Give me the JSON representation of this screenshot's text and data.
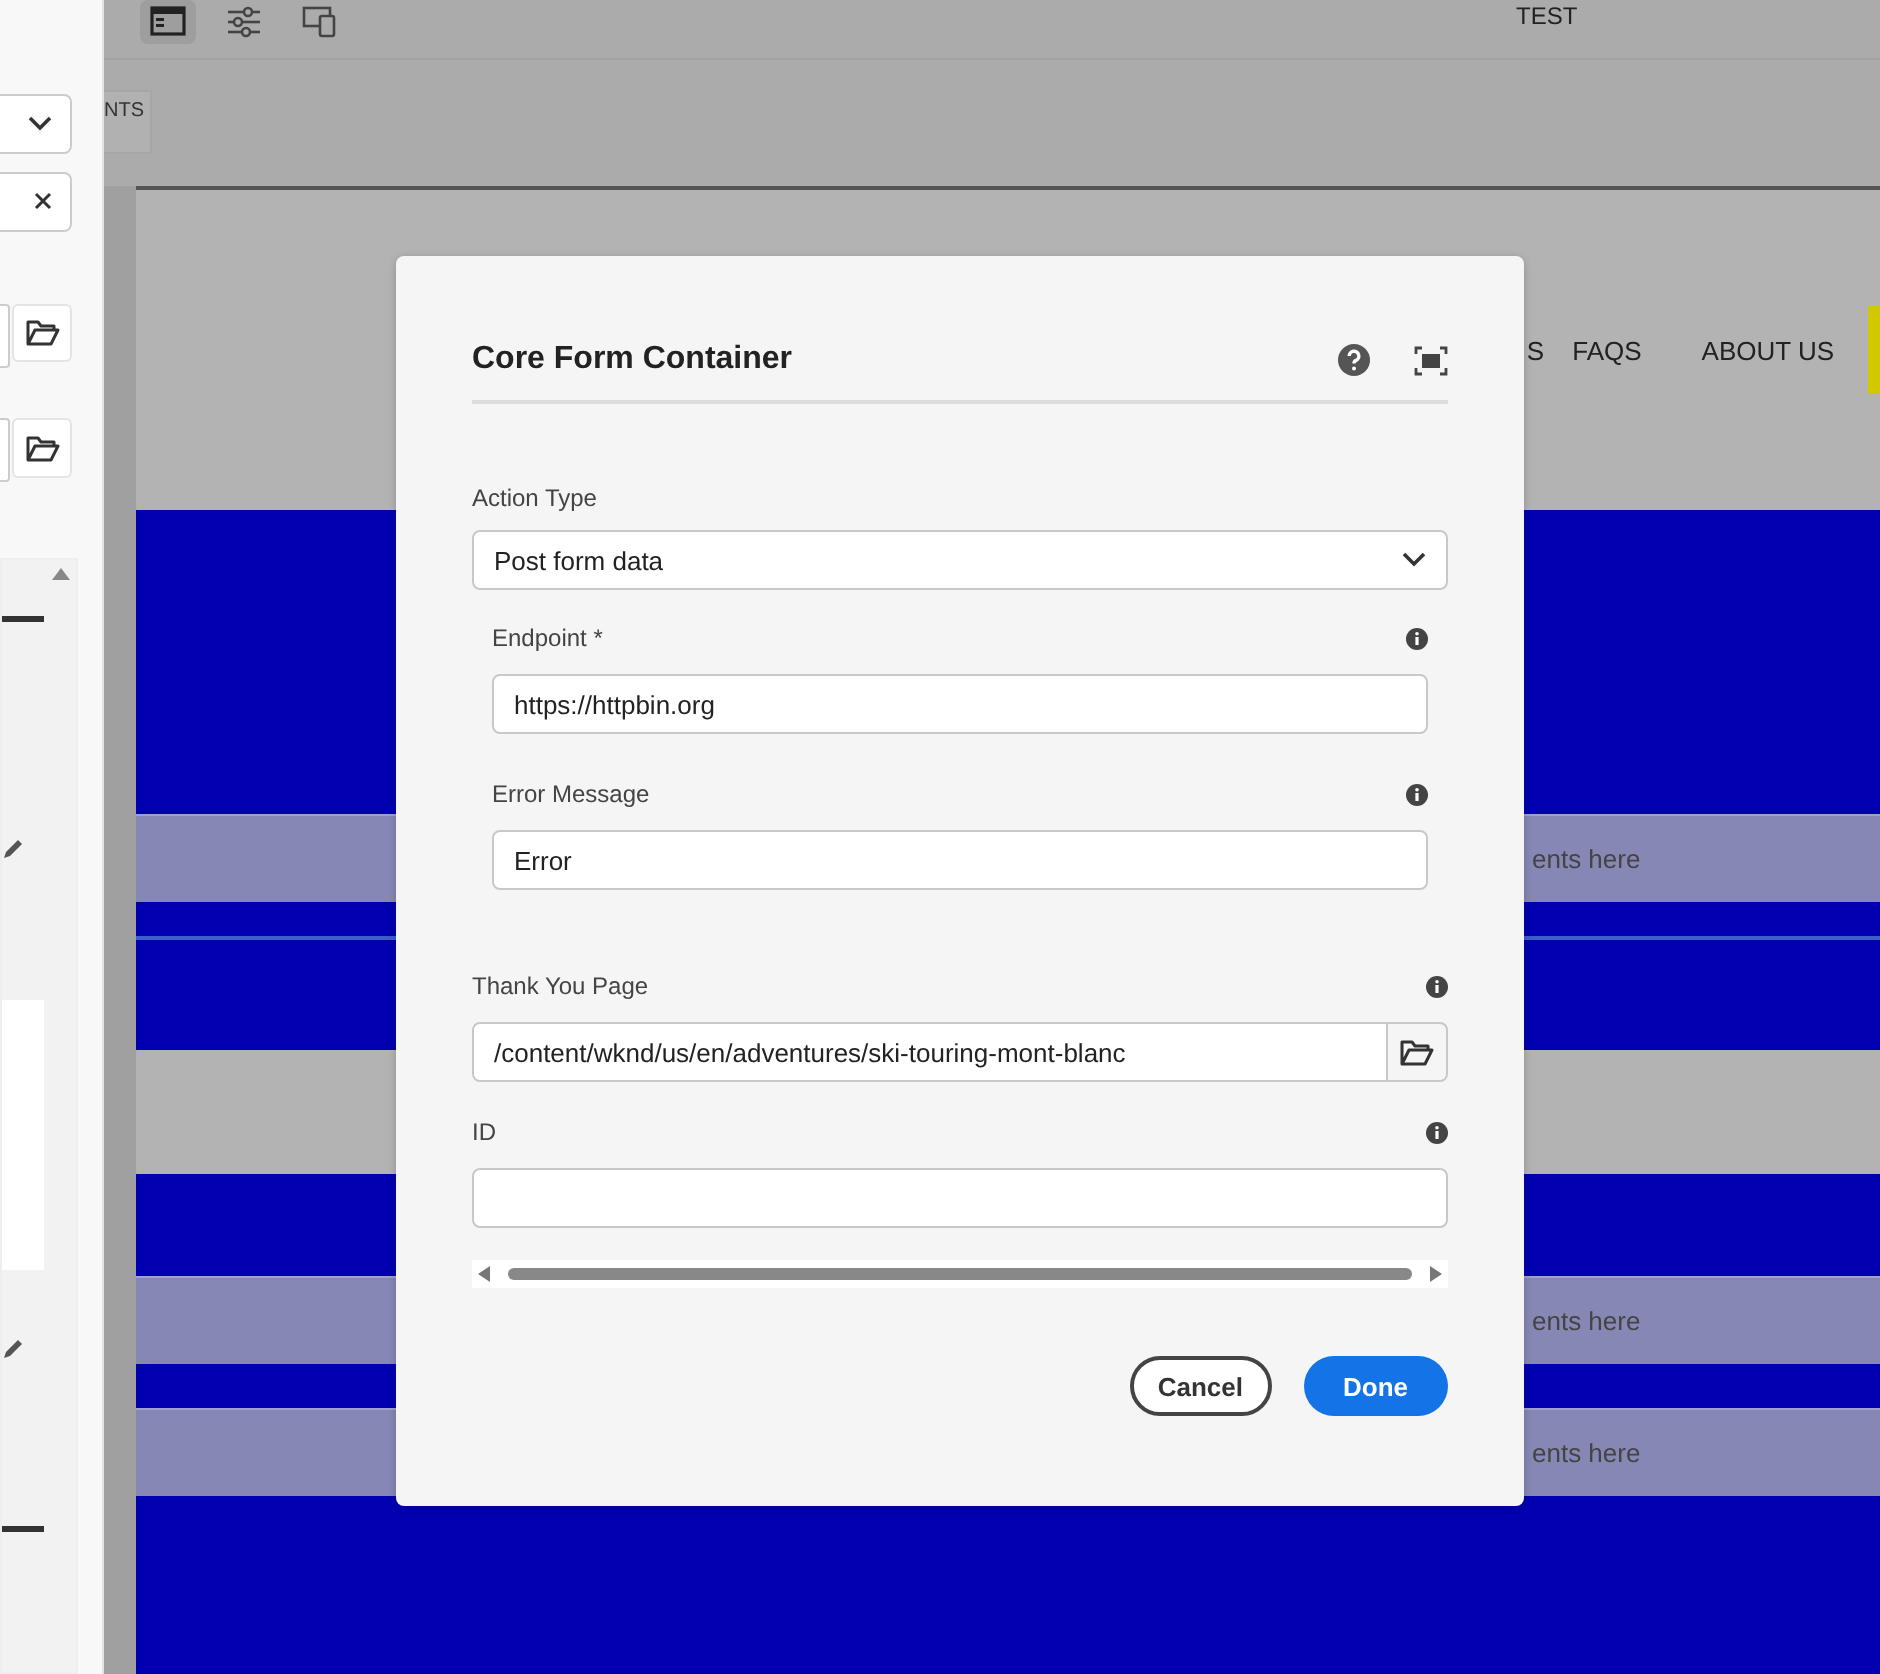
{
  "toolbar": {
    "buttons": [
      {
        "selected": true
      },
      {
        "selected": false
      },
      {
        "selected": false
      }
    ],
    "title": "TEST"
  },
  "side_tab": "NTS",
  "page": {
    "nav": [
      "S",
      "FAQS",
      "ABOUT US"
    ],
    "bands": [
      {
        "kind": "placeholder",
        "text": "ents here"
      },
      {
        "kind": "separator"
      },
      {
        "kind": "gray"
      },
      {
        "kind": "placeholder",
        "text": "ents here"
      },
      {
        "kind": "placeholder",
        "text": "ents here"
      }
    ]
  },
  "dialog": {
    "title": "Core Form Container",
    "fields": [
      {
        "kind": "select",
        "label": "Action Type",
        "value": "Post form data"
      },
      {
        "kind": "group",
        "fields": [
          {
            "kind": "text",
            "label": "Endpoint *",
            "value": "https://httpbin.org"
          },
          {
            "kind": "text",
            "label": "Error Message",
            "value": "Error"
          }
        ]
      },
      {
        "kind": "path",
        "label": "Thank You Page",
        "value": "/content/wknd/us/en/adventures/ski-touring-mont-blanc"
      },
      {
        "kind": "text",
        "label": "ID"
      }
    ],
    "buttons": [
      {
        "kind": "secondary",
        "label": "Cancel"
      },
      {
        "kind": "primary",
        "label": "Done"
      }
    ]
  }
}
